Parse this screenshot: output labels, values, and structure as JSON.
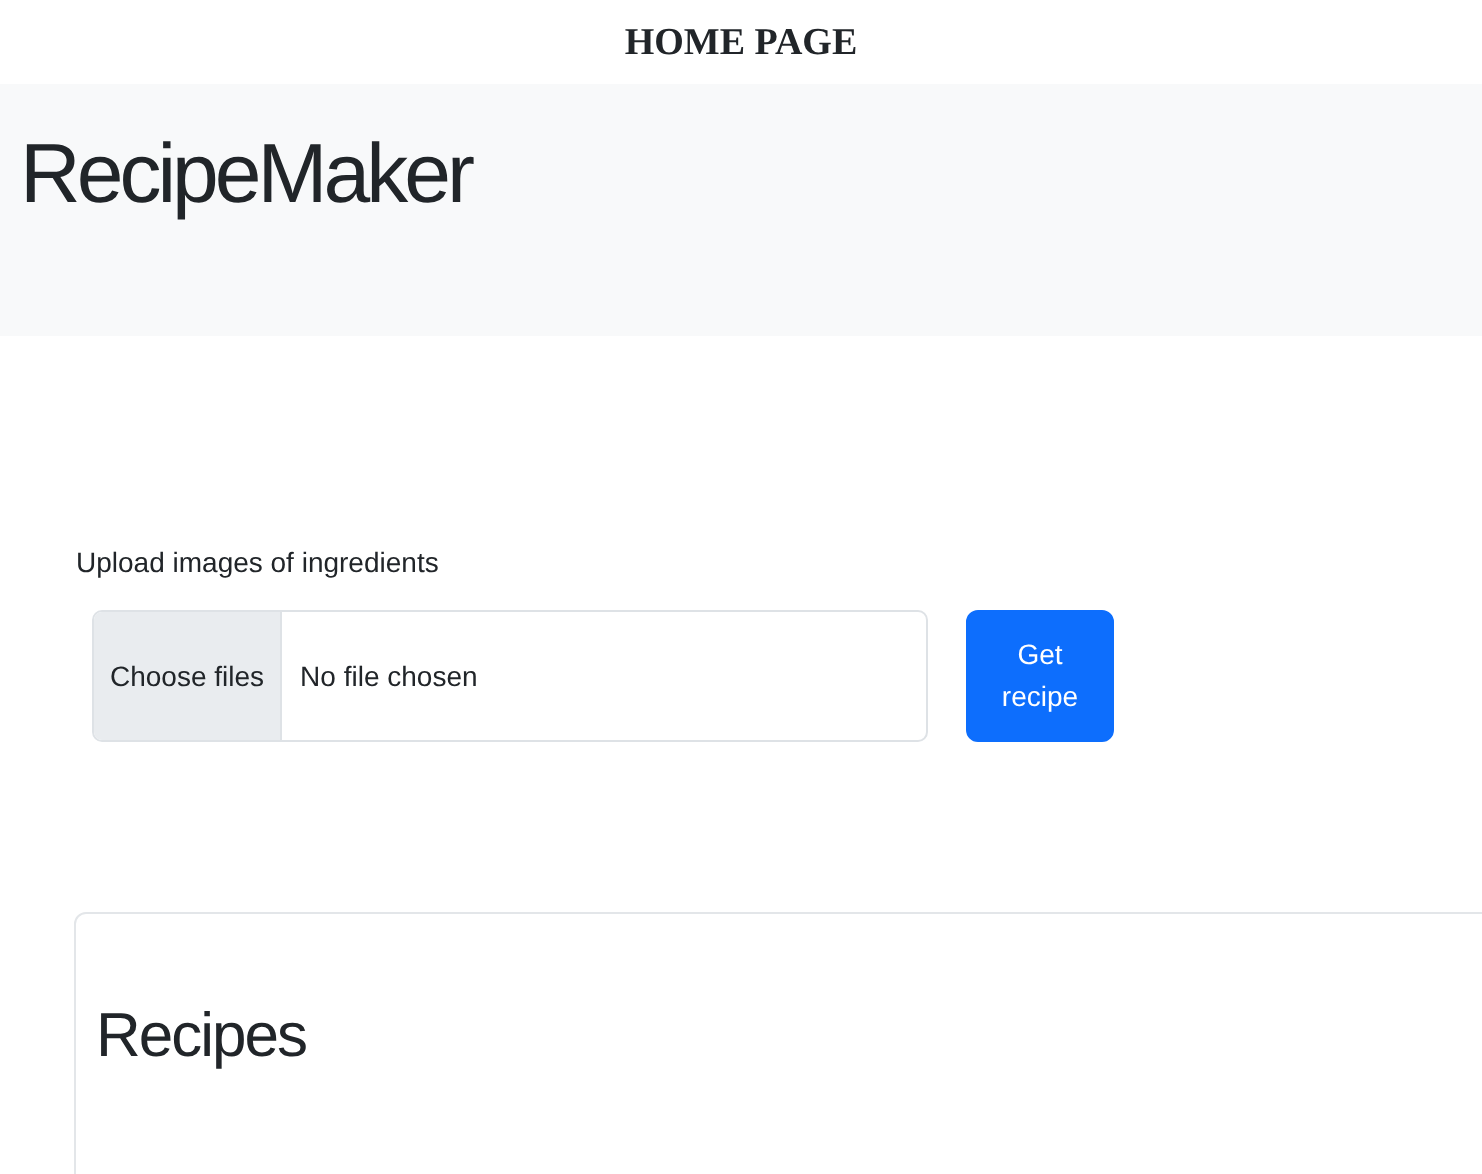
{
  "caption": "HOME PAGE",
  "navbar": {
    "brand": "RecipeMaker"
  },
  "upload": {
    "label": "Upload images of ingredients",
    "choose_button": "Choose files",
    "file_status": "No file chosen",
    "submit_button": "Get recipe"
  },
  "recipes_card": {
    "title": "Recipes"
  }
}
